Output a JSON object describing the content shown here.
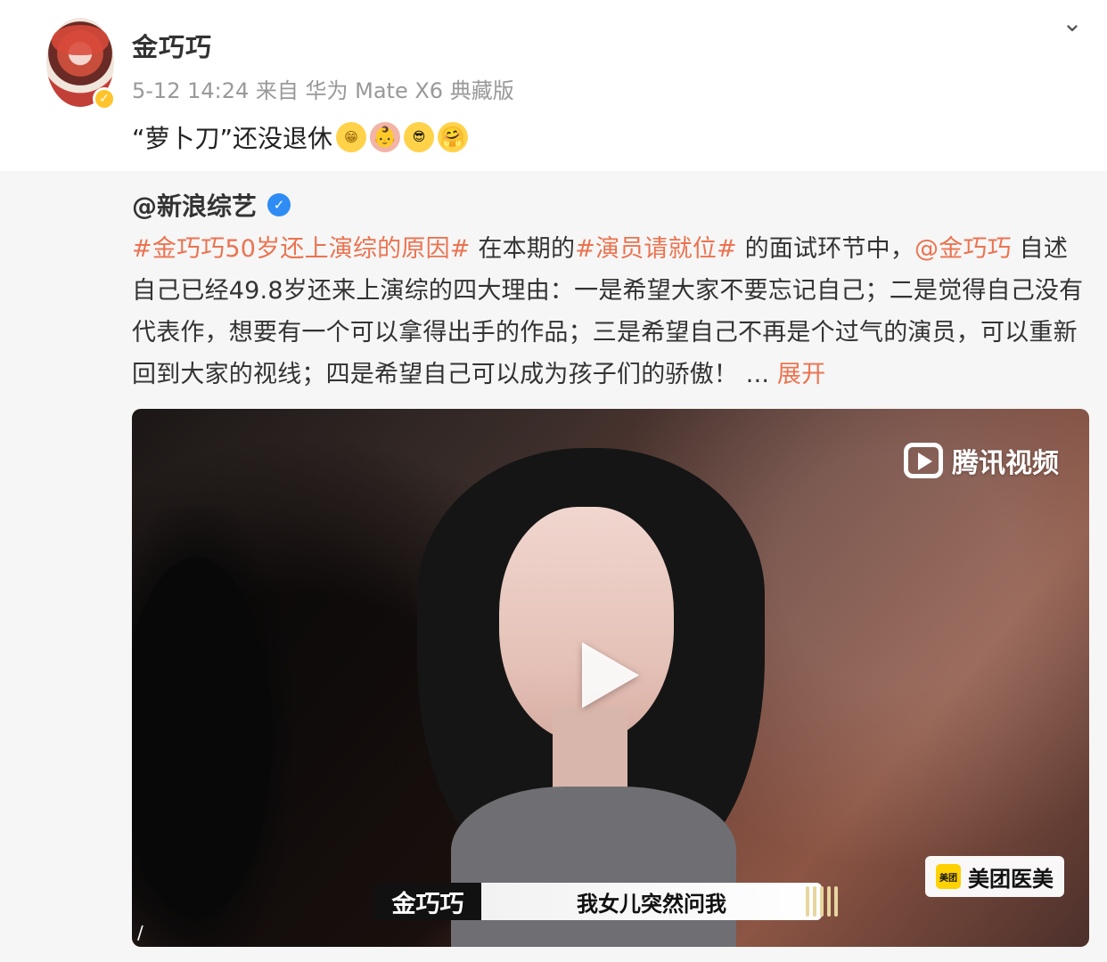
{
  "post": {
    "username": "金巧巧",
    "meta": "5-12 14:24 来自 华为 Mate X6 典藏版",
    "text": "“萝卜刀”还没退休",
    "emojis": [
      "grin",
      "baby",
      "cool",
      "hug"
    ],
    "icons": {
      "verified": "verified-badge-icon",
      "menu": "chevron-down-icon"
    }
  },
  "repost": {
    "username": "@新浪综艺",
    "verified": "verified-badge-icon",
    "text": {
      "tag1": "#金巧巧50岁还上演综的原因#",
      "part1": " 在本期的",
      "tag2": "#演员请就位#",
      "part2": " 的面试环节中，",
      "mention": "@金巧巧",
      "part3": " 自述自己已经49.8岁还来上演综的四大理由：一是希望大家不要忘记自己；二是觉得自己没有代表作，想要有一个可以拿得出手的作品；三是希望自己不再是个过气的演员，可以重新回到大家的视线；四是希望自己可以成为孩子们的骄傲！",
      "ellipsis": " ... ",
      "expand": "展开"
    }
  },
  "video": {
    "watermark": "腾讯视频",
    "sponsor_logo": "美团",
    "sponsor_text": "美团医美",
    "caption_name": "金巧巧",
    "caption_text": "我女儿突然问我",
    "corner_mark": "/",
    "colors": {
      "accent": "#eb7350",
      "verified_gold": "#ffc42b",
      "verified_blue": "#2f8cf4"
    }
  }
}
